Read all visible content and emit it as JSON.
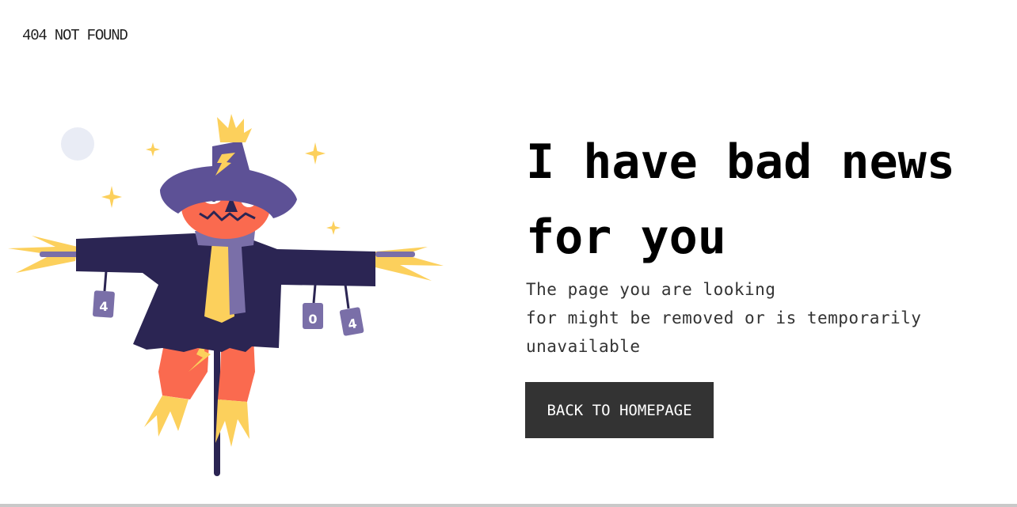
{
  "brand": {
    "text": "404 NOT FOUND"
  },
  "headline": {
    "line1": "I have bad news",
    "line2": "for you"
  },
  "message": {
    "line1": "The page you are looking",
    "line2": "for might be removed or is temporarily",
    "line3": "unavailable"
  },
  "button": {
    "label": "BACK TO HOMEPAGE"
  },
  "illustration": {
    "subject": "scarecrow",
    "cans": [
      "4",
      "0",
      "4"
    ]
  },
  "colors": {
    "button_bg": "#333333",
    "hat": "#5d5196",
    "coat": "#2b2553",
    "face": "#fa6a4f",
    "straw": "#fcd05c",
    "moon": "#e9ecf5",
    "can": "#7a6fa8"
  }
}
